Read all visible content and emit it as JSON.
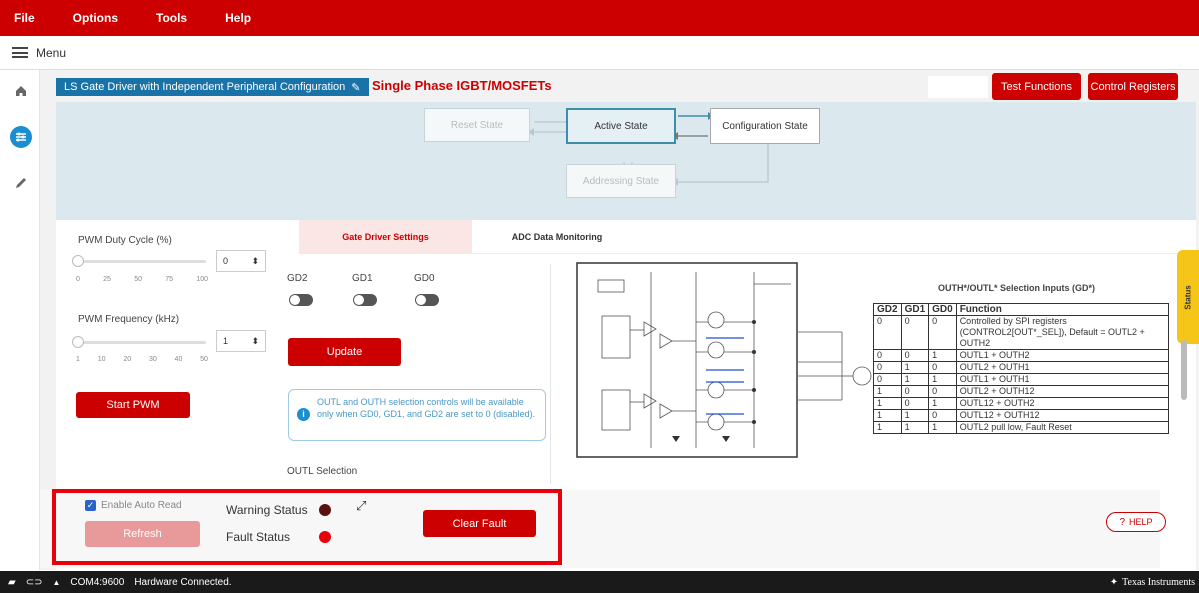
{
  "menu": {
    "items": [
      "File",
      "Options",
      "Tools",
      "Help"
    ]
  },
  "subbar": {
    "menu_label": "Menu"
  },
  "header": {
    "title": "LS Gate Driver with Independent Peripheral Configuration",
    "subtitle": "Single Phase IGBT/MOSFETs",
    "test_functions": "Test Functions",
    "control_registers": "Control Registers"
  },
  "diagram": {
    "states": [
      "Reset State",
      "Active State",
      "Configuration State",
      "Addressing State"
    ]
  },
  "left": {
    "pwm_duty_label": "PWM Duty Cycle (%)",
    "pwm_duty_value": "0",
    "pwm_duty_ticks": [
      "0",
      "25",
      "50",
      "75",
      "100"
    ],
    "pwm_freq_label": "PWM Frequency (kHz)",
    "pwm_freq_value": "1",
    "pwm_freq_ticks": [
      "1",
      "10",
      "20",
      "30",
      "40",
      "50"
    ],
    "start_pwm": "Start PWM"
  },
  "tabs": {
    "gate_driver": "Gate Driver Settings",
    "adc": "ADC Data Monitoring"
  },
  "gd": {
    "labels": [
      "GD2",
      "GD1",
      "GD0"
    ],
    "update": "Update",
    "info": "OUTL and OUTH selection controls will be available only when GD0, GD1, and GD2 are set to 0 (disabled).",
    "outl_selection": "OUTL Selection"
  },
  "table": {
    "caption": "OUTH*/OUTL* Selection Inputs (GD*)",
    "headers": [
      "GD2",
      "GD1",
      "GD0",
      "Function"
    ],
    "rows": [
      [
        "0",
        "0",
        "0",
        "Controlled by SPI registers (CONTROL2[OUT*_SEL]), Default = OUTL2 + OUTH2"
      ],
      [
        "0",
        "0",
        "1",
        "OUTL1 + OUTH2"
      ],
      [
        "0",
        "1",
        "0",
        "OUTL2 + OUTH1"
      ],
      [
        "0",
        "1",
        "1",
        "OUTL1 + OUTH1"
      ],
      [
        "1",
        "0",
        "0",
        "OUTL2 + OUTH12"
      ],
      [
        "1",
        "0",
        "1",
        "OUTL12 + OUTH2"
      ],
      [
        "1",
        "1",
        "0",
        "OUTL12 + OUTH12"
      ],
      [
        "1",
        "1",
        "1",
        "OUTL2 pull low, Fault Reset"
      ]
    ]
  },
  "side": {
    "status_tab": "Status"
  },
  "bottom": {
    "auto_read": "Enable Auto Read",
    "refresh": "Refresh",
    "warning_status": "Warning Status",
    "fault_status": "Fault Status",
    "clear_fault": "Clear Fault",
    "help": "HELP",
    "colors": {
      "warning_led": "#5a1010",
      "fault_led": "#e8000b"
    }
  },
  "footer": {
    "port": "COM4:9600",
    "status": "Hardware Connected.",
    "brand": "Texas Instruments"
  }
}
